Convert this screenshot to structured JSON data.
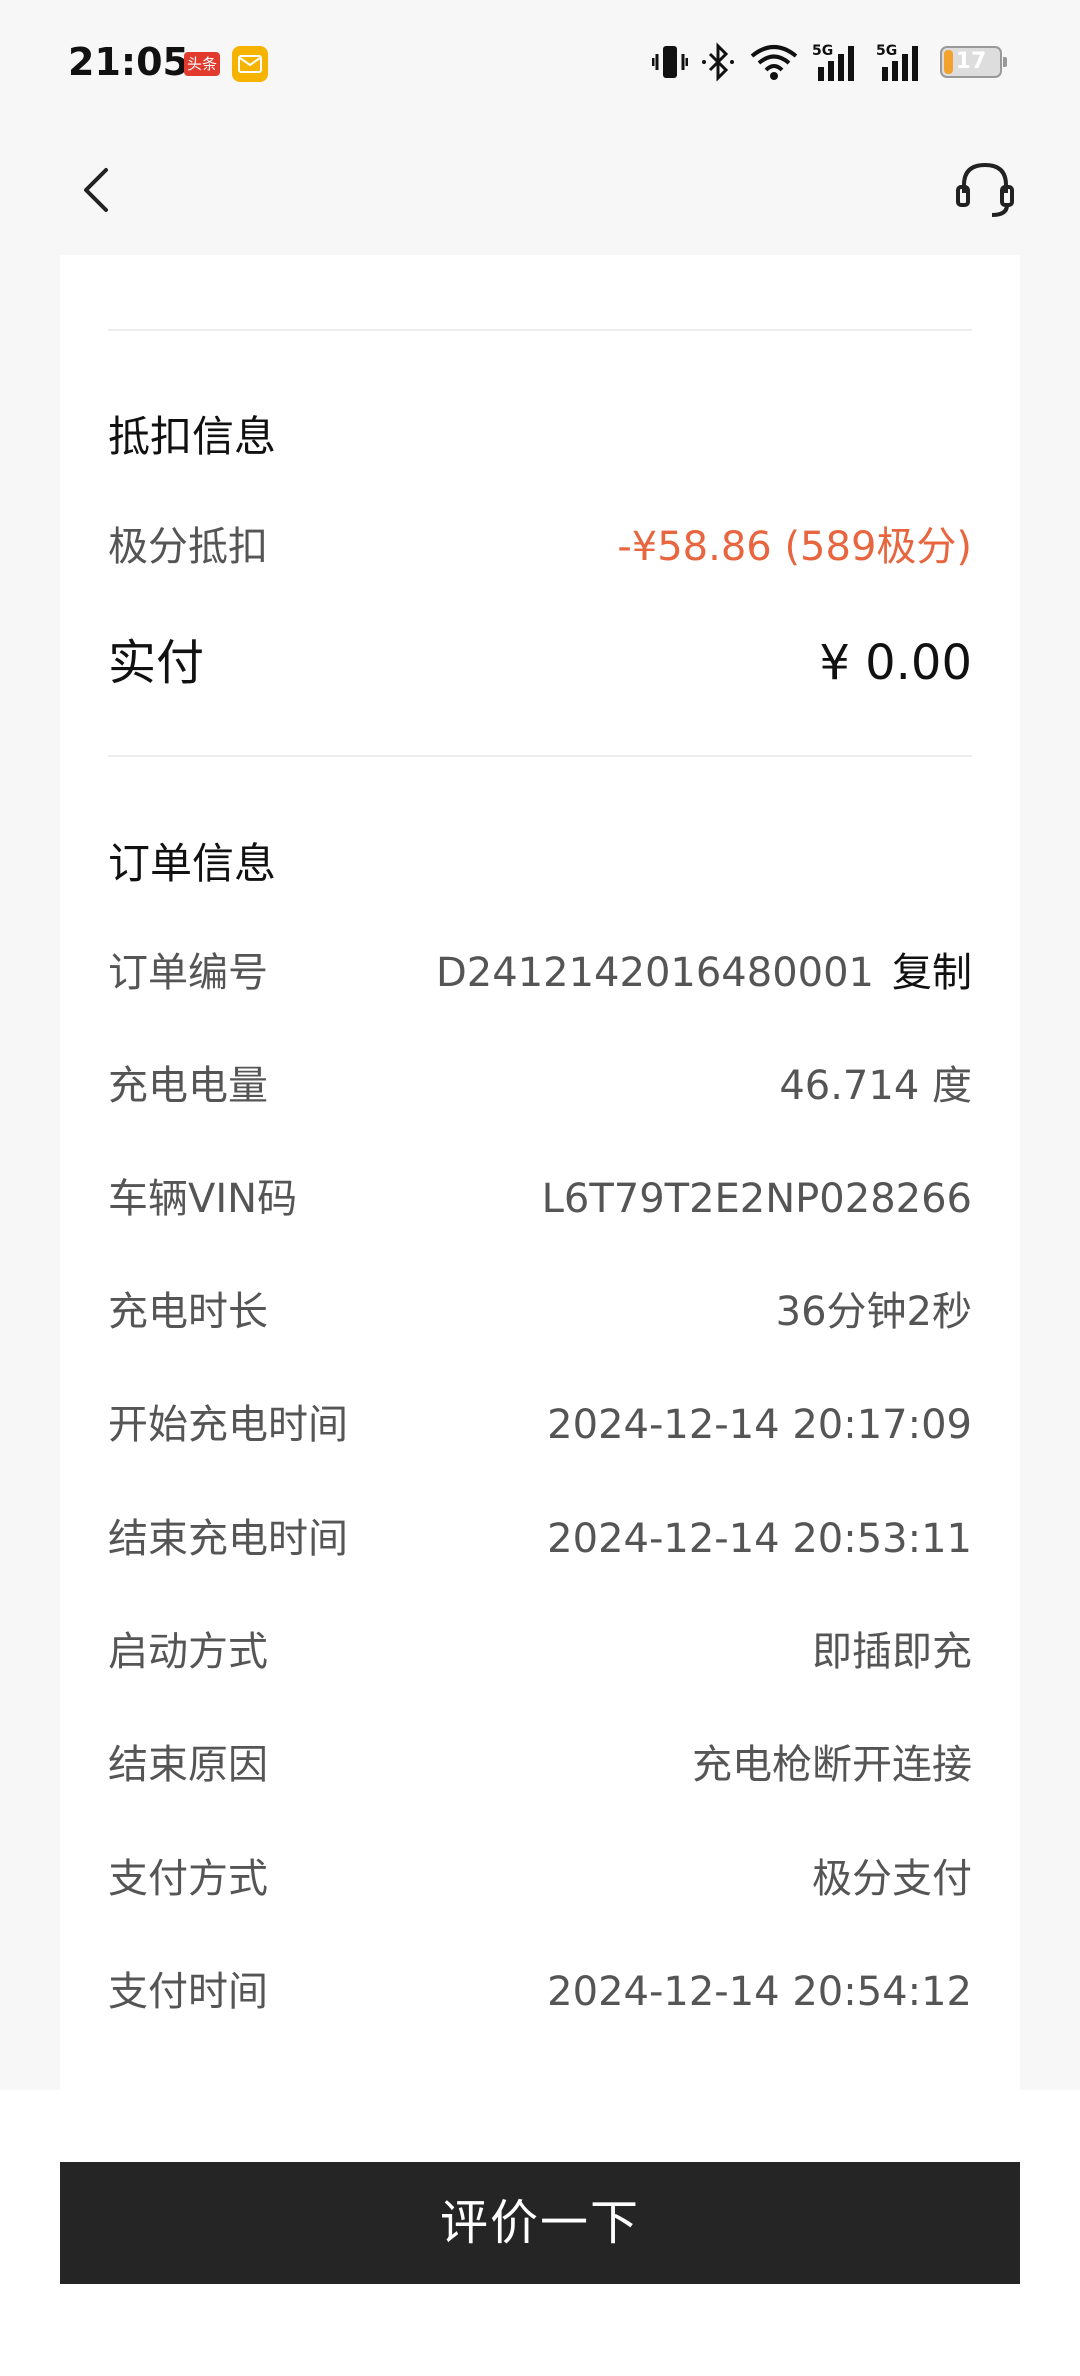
{
  "status_bar": {
    "time": "21:05",
    "app1_badge": "头条",
    "battery": "17",
    "battery_level": 0.17,
    "icons": [
      "vibrate-icon",
      "bluetooth-icon",
      "wifi-icon",
      "signal-5g-icon",
      "signal-5g-icon",
      "battery-icon"
    ]
  },
  "nav": {
    "back_icon": "chevron-left-icon",
    "service_icon": "headset-icon"
  },
  "deduction": {
    "title": "抵扣信息",
    "points_label": "极分抵扣",
    "points_value": "-¥58.86 (589极分)",
    "paid_label": "实付",
    "paid_value": "¥ 0.00"
  },
  "order": {
    "title": "订单信息",
    "rows": [
      {
        "label": "订单编号",
        "value": "D2412142016480001",
        "action": "复制"
      },
      {
        "label": "充电电量",
        "value": "46.714 度"
      },
      {
        "label": "车辆VIN码",
        "value": "L6T79T2E2NP028266"
      },
      {
        "label": "充电时长",
        "value": "36分钟2秒"
      },
      {
        "label": "开始充电时间",
        "value": "2024-12-14 20:17:09"
      },
      {
        "label": "结束充电时间",
        "value": "2024-12-14 20:53:11"
      },
      {
        "label": "启动方式",
        "value": "即插即充"
      },
      {
        "label": "结束原因",
        "value": "充电枪断开连接"
      },
      {
        "label": "支付方式",
        "value": "极分支付"
      },
      {
        "label": "支付时间",
        "value": "2024-12-14 20:54:12"
      }
    ]
  },
  "footer": {
    "rate_button": "评价一下"
  },
  "colors": {
    "accent_discount": "#e8663f",
    "button_bg": "#252525",
    "page_bg": "#f7f7f7"
  }
}
